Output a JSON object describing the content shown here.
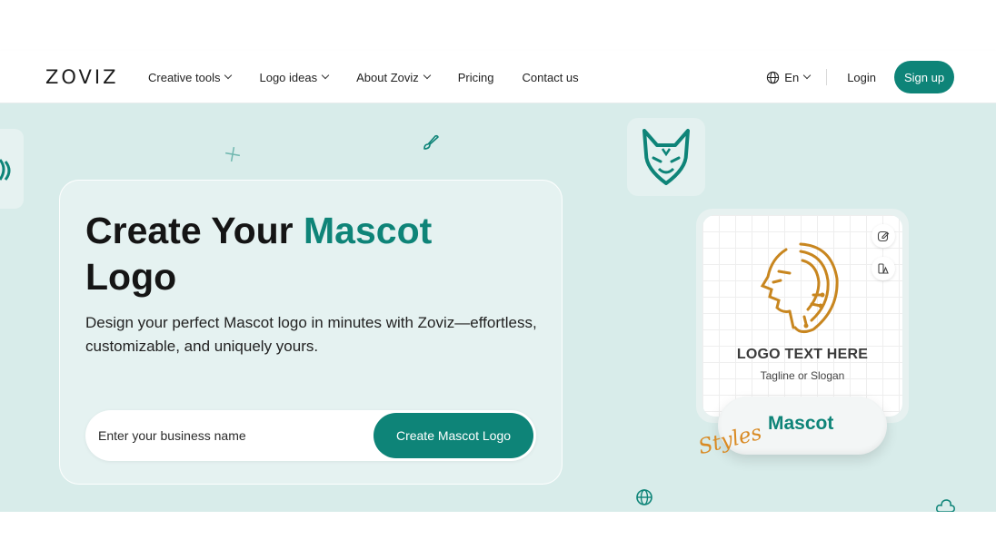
{
  "header": {
    "logo": "ZOVIZ",
    "nav": [
      {
        "label": "Creative tools",
        "dropdown": true
      },
      {
        "label": "Logo ideas",
        "dropdown": true
      },
      {
        "label": "About Zoviz",
        "dropdown": true
      },
      {
        "label": "Pricing",
        "dropdown": false
      },
      {
        "label": "Contact us",
        "dropdown": false
      }
    ],
    "language": "En",
    "login": "Login",
    "signup": "Sign up"
  },
  "hero": {
    "title_part1": "Create Your ",
    "title_accent": "Mascot",
    "title_part2": "Logo",
    "subtitle": "Design your perfect Mascot logo in minutes with Zoviz—effortless, customizable, and uniquely yours.",
    "input_placeholder": "Enter your business name",
    "cta": "Create Mascot Logo"
  },
  "preview": {
    "logo_text": "LOGO TEXT HERE",
    "tagline": "Tagline or Slogan",
    "style_script": "Styles",
    "style_name": "Mascot"
  },
  "colors": {
    "brand": "#0e8478",
    "hero_bg": "#d8ecea",
    "accent_orange": "#d98a23",
    "lion_gold": "#c8861f"
  }
}
